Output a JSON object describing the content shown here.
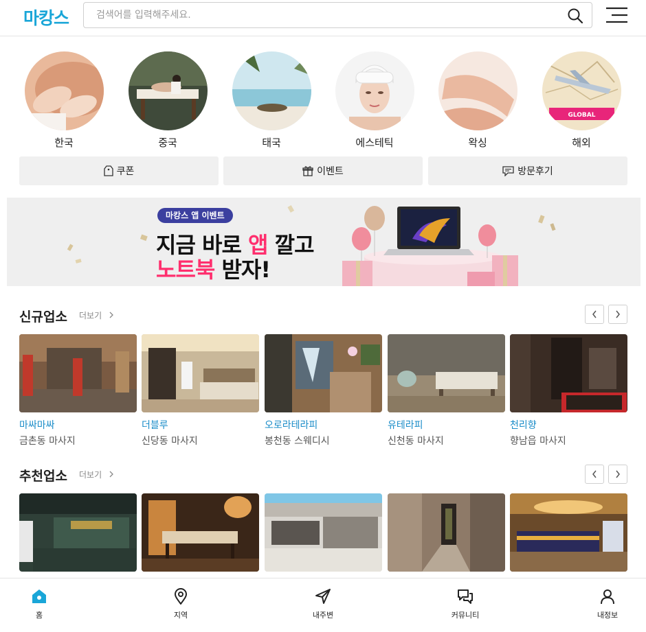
{
  "header": {
    "logo": "마캉스",
    "search_placeholder": "검색어를 입력해주세요."
  },
  "categories": [
    {
      "label": "한국"
    },
    {
      "label": "중국"
    },
    {
      "label": "태국"
    },
    {
      "label": "에스테틱"
    },
    {
      "label": "왁싱"
    },
    {
      "label": "해외",
      "badge": "GLOBAL"
    }
  ],
  "quick_buttons": [
    {
      "label": "쿠폰"
    },
    {
      "label": "이벤트"
    },
    {
      "label": "방문후기"
    }
  ],
  "banner": {
    "tag": "마캉스 앱 이벤트",
    "line1_a": "지금 바로 ",
    "line1_b": "앱",
    "line1_c": " 깔고",
    "line2_a": "노트북",
    "line2_b": " 받자!"
  },
  "sections": {
    "new": {
      "title": "신규업소",
      "more": "더보기",
      "items": [
        {
          "name": "마싸마싸",
          "area": "금촌동 마사지"
        },
        {
          "name": "더블루",
          "area": "신당동 마사지"
        },
        {
          "name": "오로라테라피",
          "area": "봉천동 스웨디시"
        },
        {
          "name": "유테라피",
          "area": "신천동 마사지"
        },
        {
          "name": "천리향",
          "area": "향남읍 마사지"
        }
      ]
    },
    "recommended": {
      "title": "추천업소",
      "more": "더보기"
    }
  },
  "bottom_nav": [
    {
      "label": "홈",
      "active": true
    },
    {
      "label": "지역"
    },
    {
      "label": "내주변"
    },
    {
      "label": "커뮤니티"
    },
    {
      "label": "내정보"
    }
  ],
  "colors": {
    "brand": "#1aa6d8",
    "place_name": "#1a8cc8",
    "banner_tag": "#3b3f9f",
    "banner_accent": "#ff2f6e"
  }
}
